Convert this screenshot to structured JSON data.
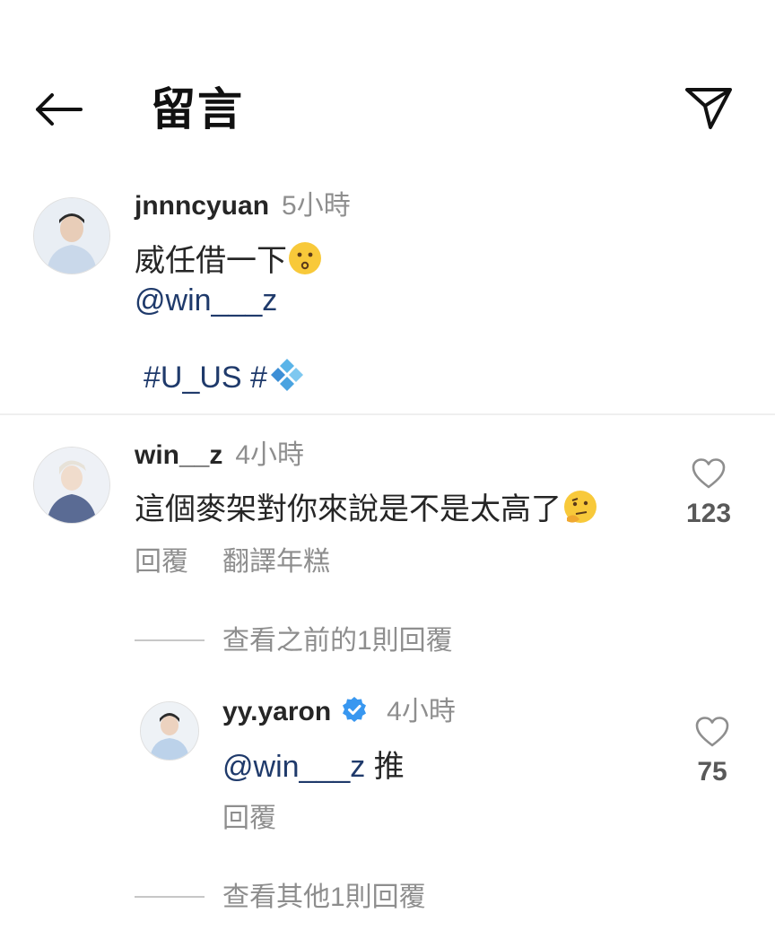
{
  "header": {
    "title": "留言"
  },
  "caption": {
    "username": "jnnncyuan",
    "time": "5小時",
    "line1": "威任借一下",
    "mention": "@win___z",
    "hashtag": "#U_US #"
  },
  "comments": [
    {
      "username": "win__z",
      "time": "4小時",
      "text": "這個麥架對你來說是不是太高了",
      "reply_label": "回覆",
      "translate_label": "翻譯年糕",
      "likes": "123",
      "view_previous": "查看之前的1則回覆",
      "replies": [
        {
          "username": "yy.yaron",
          "verified": true,
          "time": "4小時",
          "mention": "@win___z",
          "text": " 推",
          "reply_label": "回覆",
          "likes": "75"
        }
      ],
      "view_more": "查看其他1則回覆"
    }
  ],
  "colors": {
    "mention": "#1f3a6b",
    "verified": "#3897f0",
    "muted": "#8e8e8e"
  }
}
